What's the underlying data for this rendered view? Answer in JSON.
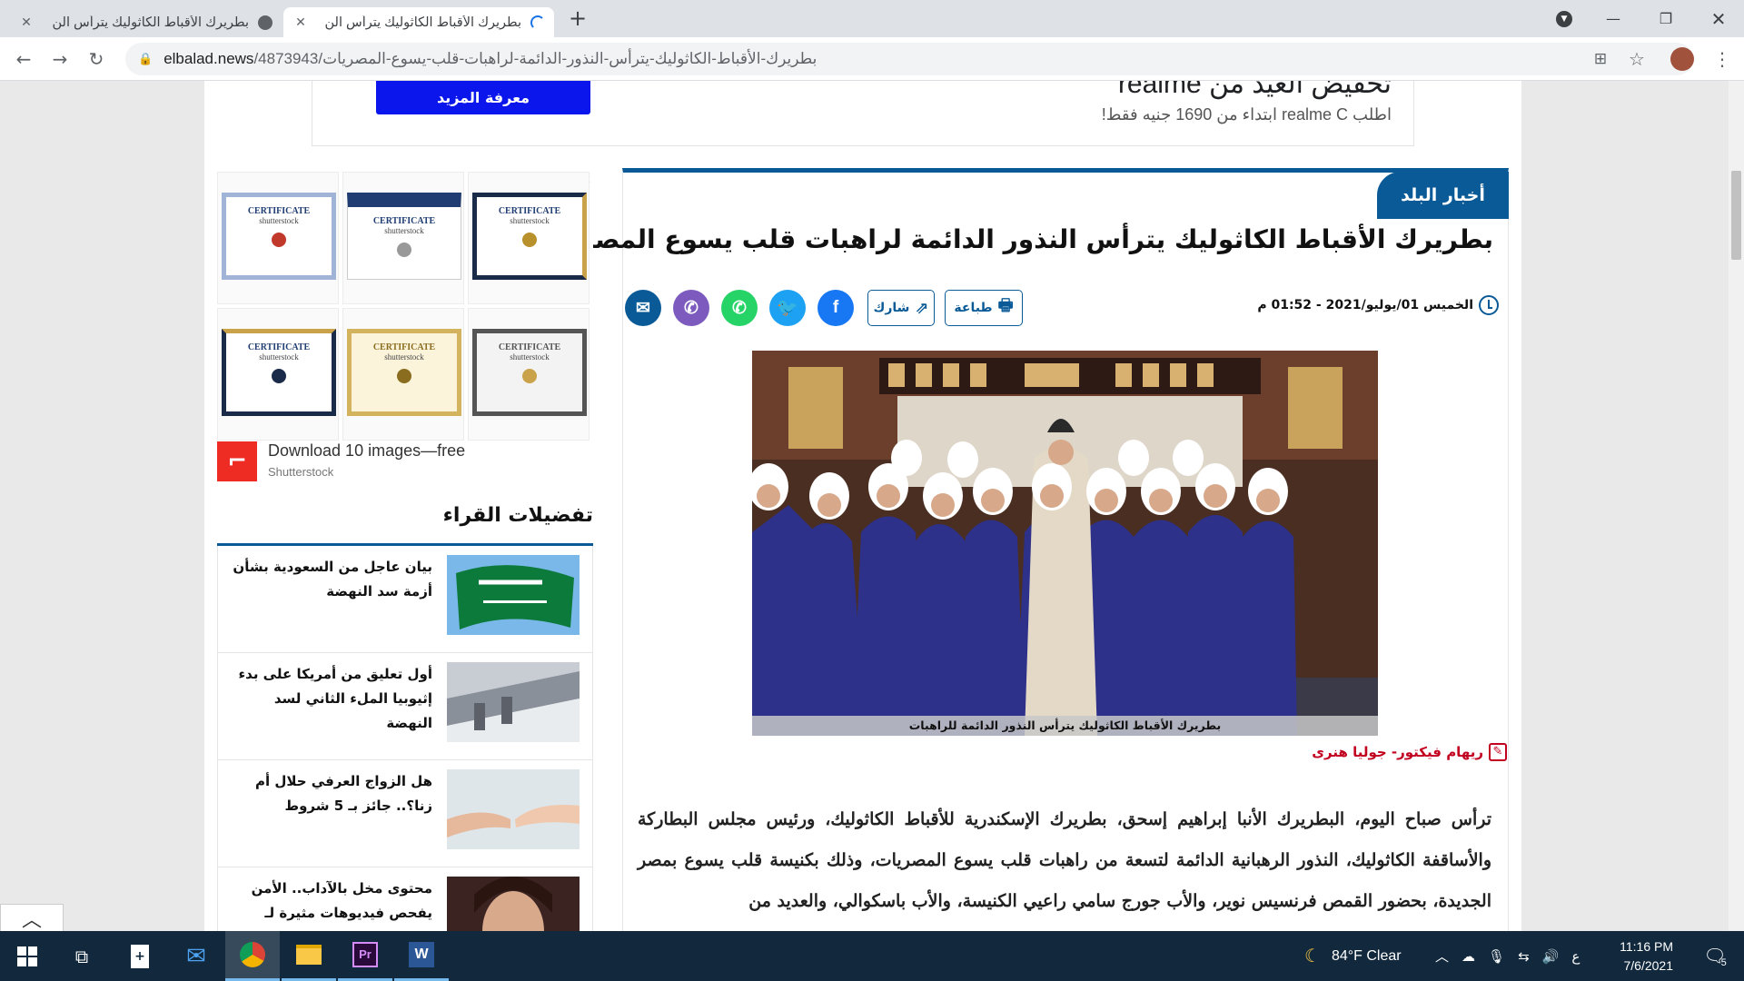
{
  "browser": {
    "tabs": [
      {
        "title": "بطريرك الأقباط الكاثوليك يترأس الن",
        "active": false
      },
      {
        "title": "بطريرك الأقباط الكاثوليك يترأس الن",
        "active": true
      }
    ],
    "new_tab": "+",
    "url_domain": "elbalad.news",
    "url_path": "/4873943/بطريرك-الأقباط-الكاثوليك-يترأس-النذور-الدائمة-لراهبات-قلب-يسوع-المصريات"
  },
  "top_ad": {
    "headline": "تخفيض العيد من realme",
    "subline": "اطلب realme C ابتداء من 1690 جنيه فقط!",
    "button": "معرفة المزيد"
  },
  "article": {
    "category": "أخبار البلد",
    "headline": "بطريرك الأقباط الكاثوليك يترأس النذور الدائمة لراهبات قلب يسوع المصريات",
    "date": "الخميس 01/يوليو/2021 - 01:52 م",
    "print_label": "طباعة",
    "share_label": "شارك",
    "image_caption": "بطريرك الأقباط الكاثوليك يترأس النذور الدائمة للراهبات",
    "authors": "ريهام فيكتور- جوليا هنرى",
    "body": "ترأس صباح اليوم،  البطريرك الأنبا إبراهيم إسحق، بطريرك الإسكندرية للأقباط الكاثوليك، ورئيس مجلس البطاركة والأساقفة الكاثوليك، النذور الرهبانية الدائمة لتسعة من راهبات قلب يسوع المصريات، وذلك بكنيسة قلب يسوع بمصر الجديدة، بحضور القمص فرنسيس نوير، والأب جورج سامي راعيي الكنيسة، والأب باسكوالي، والعديد من"
  },
  "side_ad": {
    "cert_word": "CERTIFICATE",
    "title": "Download 10 images—free",
    "brand": "Shutterstock"
  },
  "readers_picks": {
    "title": "تفضيلات القراء",
    "items": [
      {
        "text": "بيان عاجل من السعودية بشأن أزمة سد النهضة"
      },
      {
        "text": "أول تعليق من أمريكا على بدء إثيوبيا الملء الثاني لسد النهضة"
      },
      {
        "text": "هل الزواج العرفي حلال أم زنا؟.. جائز بـ 5 شروط"
      },
      {
        "text": "محتوى مخل بالآداب.. الأمن يفحص فيديوهات مثيرة لـ موكا"
      }
    ]
  },
  "taskbar": {
    "weather": "84°F  Clear",
    "lang": "ع",
    "time": "11:16 PM",
    "date": "7/6/2021",
    "notifications": "5"
  },
  "colors": {
    "brand_blue": "#0a5a97",
    "ad_button": "#0b16ec",
    "byline_red": "#c2001f",
    "taskbar": "#11283d"
  }
}
